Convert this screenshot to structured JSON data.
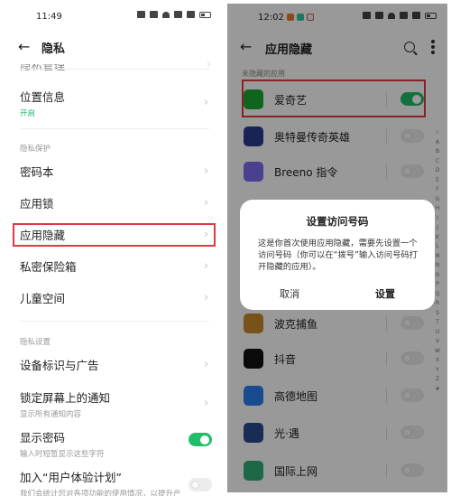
{
  "left_phone": {
    "status_bar": {
      "time": "11:49"
    },
    "header": {
      "back_icon": "arrow-left-icon",
      "title": "隐私"
    },
    "partially_visible_item": "隐私管理",
    "items_top": [
      {
        "label": "位置信息",
        "sub": "开启"
      }
    ],
    "section_privacy_protection": "隐私保护",
    "privacy_items": [
      {
        "label": "密码本"
      },
      {
        "label": "应用锁"
      },
      {
        "label": "应用隐藏",
        "highlighted": true
      },
      {
        "label": "私密保险箱"
      },
      {
        "label": "儿童空间"
      }
    ],
    "section_privacy_settings": "隐私设置",
    "settings_items": [
      {
        "label": "设备标识与广告"
      },
      {
        "label": "锁定屏幕上的通知",
        "sub": "显示所有通知内容"
      },
      {
        "label": "显示密码",
        "sub": "输入时短暂显示这些字符",
        "toggle": true
      },
      {
        "label": "加入“用户体验计划”",
        "sub": "我们会统计您对各项功能的使用情况，以提升产",
        "toggle": false
      }
    ],
    "colors": {
      "accent_green": "#1fbf6a",
      "highlight_red": "#e0393e"
    }
  },
  "right_phone": {
    "status_bar": {
      "time": "12:02"
    },
    "header": {
      "back_icon": "arrow-left-icon",
      "title": "应用隐藏",
      "search_icon": "search-icon",
      "more_icon": "more-vertical-icon"
    },
    "section_label": "未隐藏的应用",
    "apps": [
      {
        "name": "爱奇艺",
        "hidden": true,
        "icon_color": "#1aa832",
        "highlighted": true
      },
      {
        "name": "奥特曼传奇英雄",
        "hidden": false,
        "icon_color": "#2a3c8c"
      },
      {
        "name": "Breeno 指令",
        "hidden": false,
        "icon_color": "#7a6cf0"
      },
      {
        "name": "波克捕鱼",
        "hidden": false,
        "icon_color": "#c98a2b"
      },
      {
        "name": "抖音",
        "hidden": false,
        "icon_color": "#111111"
      },
      {
        "name": "高德地图",
        "hidden": false,
        "icon_color": "#2b7df0"
      },
      {
        "name": "光·遇",
        "hidden": false,
        "icon_color": "#2a4a8a"
      },
      {
        "name": "国际上网",
        "hidden": false,
        "icon_color": "#2fae78"
      }
    ],
    "alphabet_index": [
      "☆",
      "A",
      "B",
      "C",
      "D",
      "E",
      "F",
      "G",
      "H",
      "I",
      "J",
      "K",
      "L",
      "M",
      "N",
      "O",
      "P",
      "Q",
      "R",
      "S",
      "T",
      "U",
      "V",
      "W",
      "X",
      "Y",
      "Z",
      "#"
    ],
    "dialog": {
      "title": "设置访问号码",
      "body": "这是你首次使用应用隐藏，需要先设置一个访问号码（你可以在“拨号”输入访问号码打开隐藏的应用）。",
      "cancel": "取消",
      "confirm": "设置"
    }
  }
}
